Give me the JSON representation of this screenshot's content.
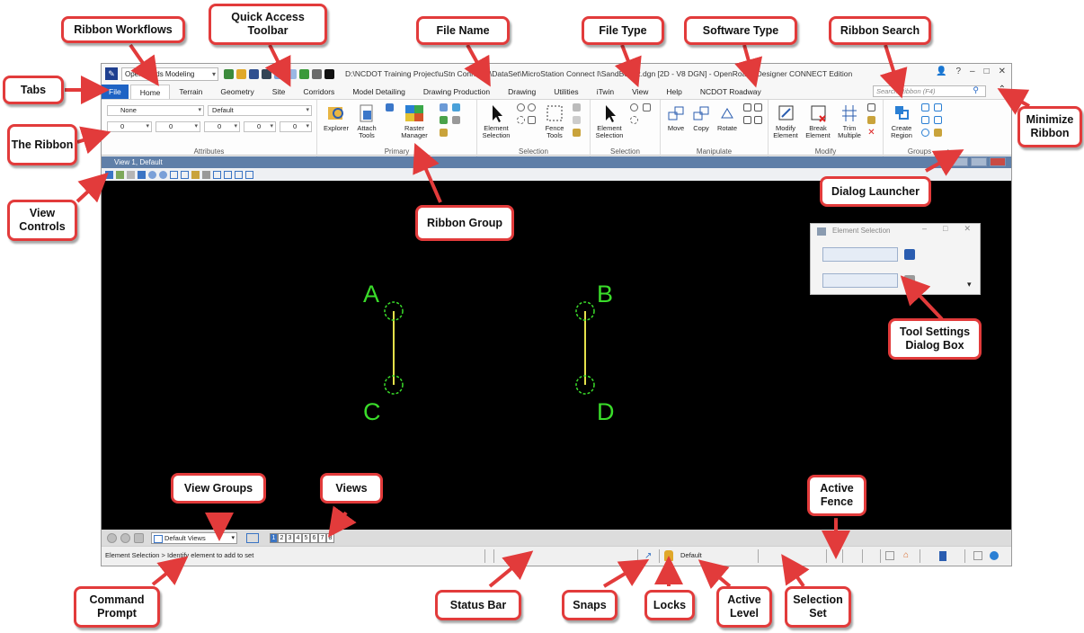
{
  "window": {
    "workflow": "OpenRoads Modeling",
    "title": "D:\\NCDOT Training Project\\uStn Connect I\\DataSet\\MicroStation Connect I\\SandBox02.dgn [2D - V8 DGN] - OpenRoads Designer CONNECT Edition",
    "controls": [
      "?",
      "–",
      "□",
      "✕"
    ]
  },
  "tabs": [
    "File",
    "Home",
    "Terrain",
    "Geometry",
    "Site",
    "Corridors",
    "Model Detailing",
    "Drawing Production",
    "Drawing",
    "Utilities",
    "iTwin",
    "View",
    "Help",
    "NCDOT Roadway"
  ],
  "active_tab": "Home",
  "search": {
    "placeholder": "Search Ribbon (F4)"
  },
  "ribbon": {
    "attributes": {
      "level": "None",
      "style": "Default",
      "weight": "0",
      "line_style": "0",
      "color": "0",
      "trans": "0",
      "prio": "0",
      "label": "Attributes"
    },
    "primary": {
      "explorer": "Explorer",
      "attach": "Attach Tools",
      "raster": "Raster Manager",
      "label": "Primary"
    },
    "selection": {
      "element_selection": "Element Selection",
      "fence_tools": "Fence Tools",
      "label": "Selection"
    },
    "selection2": {
      "element_selection": "Element Selection",
      "label": "Selection"
    },
    "manipulate": {
      "move": "Move",
      "copy": "Copy",
      "rotate": "Rotate",
      "label": "Manipulate"
    },
    "modify": {
      "modify_element": "Modify Element",
      "break_element": "Break Element",
      "trim_multiple": "Trim Multiple",
      "label": "Modify"
    },
    "groups": {
      "create_region": "Create Region",
      "label": "Groups"
    }
  },
  "view": {
    "title": "View 1, Default"
  },
  "canvas_points": [
    "A",
    "B",
    "C",
    "D"
  ],
  "tool_dialog": {
    "title": "Element Selection"
  },
  "bottom": {
    "view_group": "Default Views",
    "view_numbers": [
      "1",
      "2",
      "3",
      "4",
      "5",
      "6",
      "7",
      "8"
    ],
    "prompt": "Element Selection > Identify element to add to set",
    "active_level": "Default"
  },
  "callouts": {
    "ribbon_workflows": "Ribbon Workflows",
    "quick_access": "Quick Access Toolbar",
    "file_name": "File Name",
    "file_type": "File Type",
    "software_type": "Software Type",
    "ribbon_search": "Ribbon Search",
    "tabs": "Tabs",
    "the_ribbon": "The Ribbon",
    "minimize_ribbon": "Minimize Ribbon",
    "view_controls": "View Controls",
    "ribbon_group": "Ribbon Group",
    "dialog_launcher": "Dialog Launcher",
    "tool_settings": "Tool Settings Dialog Box",
    "view_groups": "View Groups",
    "views": "Views",
    "active_fence": "Active Fence",
    "command_prompt": "Command Prompt",
    "status_bar": "Status Bar",
    "snaps": "Snaps",
    "locks": "Locks",
    "active_level": "Active Level",
    "selection_set": "Selection Set"
  },
  "colors": {
    "callout_border": "#e23b3b",
    "point": "#3adc2a",
    "line": "#e4e04a",
    "file_tab": "#1e63c4"
  }
}
